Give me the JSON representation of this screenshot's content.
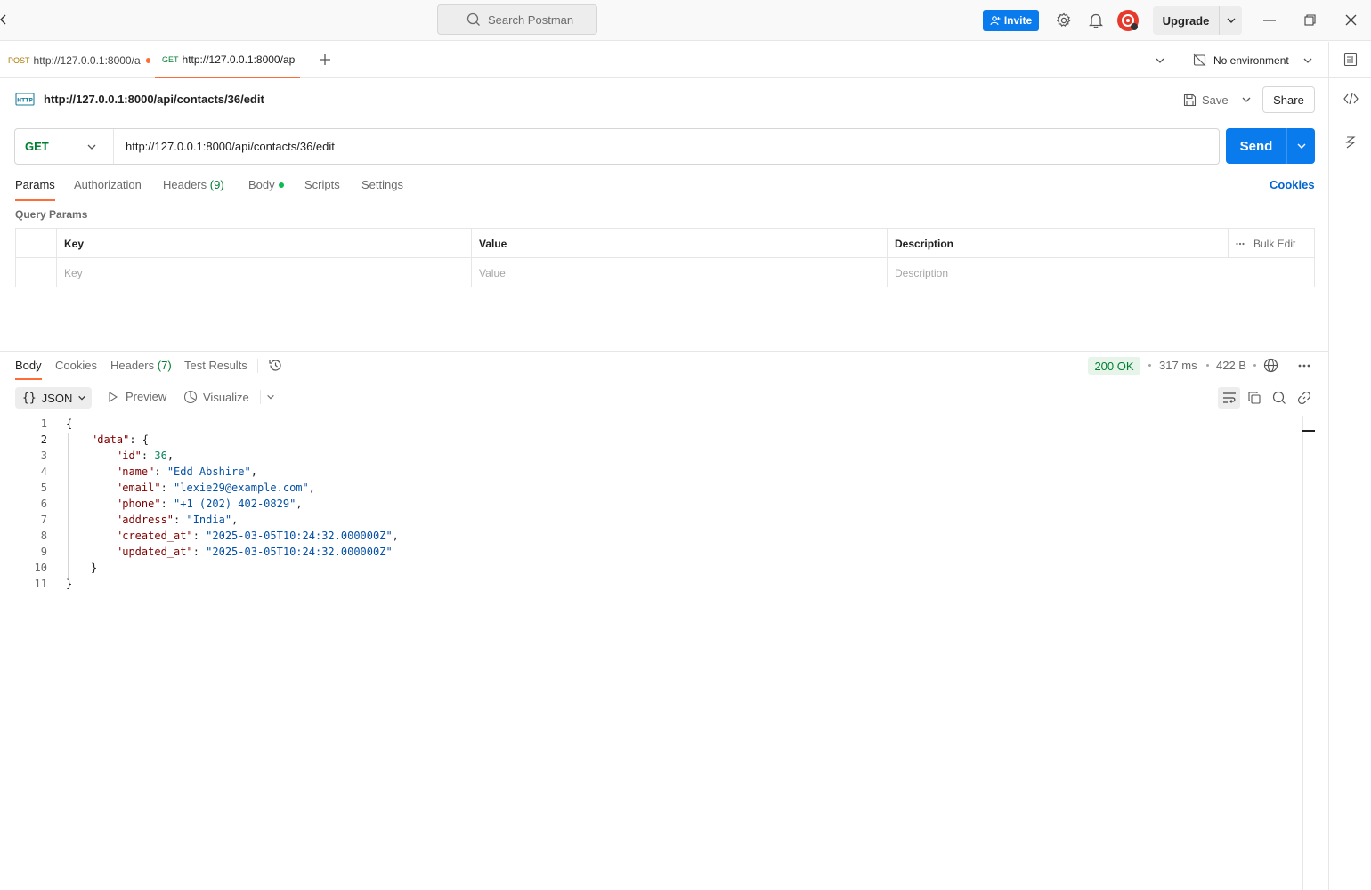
{
  "titlebar": {
    "search_placeholder": "Search Postman",
    "invite_label": "Invite",
    "upgrade_label": "Upgrade"
  },
  "tabs": [
    {
      "method": "POST",
      "url": "http://127.0.0.1:8000/a",
      "method_color": "#ad7a03"
    },
    {
      "method": "GET",
      "url": "http://127.0.0.1:8000/ap",
      "method_color": "#007f31"
    }
  ],
  "environment": {
    "label": "No environment"
  },
  "request": {
    "title": "http://127.0.0.1:8000/api/contacts/36/edit",
    "save_label": "Save",
    "share_label": "Share",
    "method": "GET",
    "url": "http://127.0.0.1:8000/api/contacts/36/edit",
    "send_label": "Send",
    "tabs": {
      "params": "Params",
      "authorization": "Authorization",
      "headers": "Headers",
      "headers_count": "(9)",
      "body": "Body",
      "scripts": "Scripts",
      "settings": "Settings"
    },
    "cookies_label": "Cookies",
    "query_params_title": "Query Params",
    "table": {
      "headers": [
        "Key",
        "Value",
        "Description"
      ],
      "bulk_edit": "Bulk Edit",
      "placeholders": [
        "Key",
        "Value",
        "Description"
      ]
    }
  },
  "response": {
    "tabs": {
      "body": "Body",
      "cookies": "Cookies",
      "headers": "Headers",
      "headers_count": "(7)",
      "test_results": "Test Results"
    },
    "status": "200 OK",
    "time": "317 ms",
    "size": "422 B",
    "format": "JSON",
    "preview_label": "Preview",
    "visualize_label": "Visualize",
    "line_numbers": [
      "1",
      "2",
      "3",
      "4",
      "5",
      "6",
      "7",
      "8",
      "9",
      "10",
      "11"
    ],
    "json": {
      "id": "36",
      "name": "\"Edd Abshire\"",
      "email": "\"lexie29@example.com\"",
      "phone": "\"+1 (202) 402-0829\"",
      "address": "\"India\"",
      "created_at": "\"2025-03-05T10:24:32.000000Z\"",
      "updated_at": "\"2025-03-05T10:24:32.000000Z\""
    }
  },
  "colors": {
    "accent": "#ff6c37",
    "primary": "#097bed",
    "get": "#007f31",
    "post": "#ad7a03",
    "json_key": "#800000",
    "json_string": "#0451a5",
    "json_number": "#098658"
  }
}
